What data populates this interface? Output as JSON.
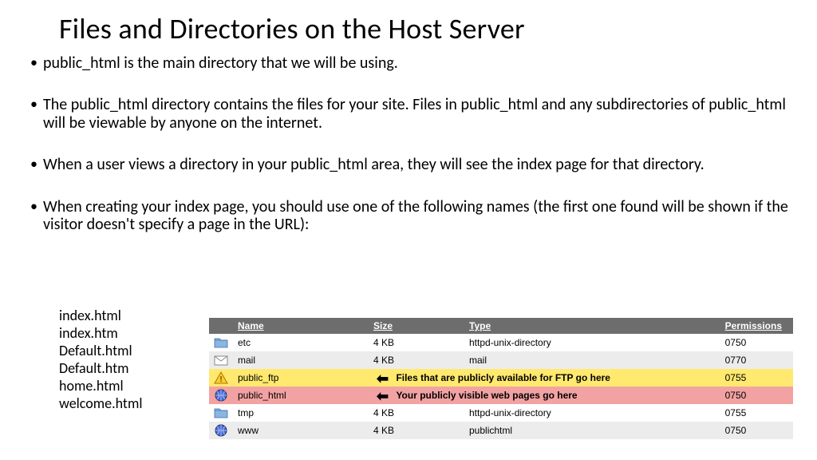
{
  "title": "Files and Directories on the Host Server",
  "bullets": [
    "public_html is the main directory that we will be using.",
    "The public_html directory contains the files for your site. Files in public_html and any subdirectories of public_html will be viewable by anyone on the internet.",
    "When a user views a directory in your public_html area, they will see the index page for that directory.",
    "When creating your index page, you should use one of the following names (the first one found will be shown if the visitor doesn't specify a page in the URL):"
  ],
  "index_names": [
    "index.html",
    "index.htm",
    "Default.html",
    "Default.htm",
    "home.html",
    "welcome.html"
  ],
  "table": {
    "headers": {
      "name": "Name",
      "size": "Size",
      "type": "Type",
      "perm": "Permissions"
    },
    "rows": [
      {
        "icon": "folder",
        "name": "etc",
        "size": "4 KB",
        "type": "httpd-unix-directory",
        "perm": "0750",
        "class": "row-even"
      },
      {
        "icon": "mail",
        "name": "mail",
        "size": "4 KB",
        "type": "mail",
        "perm": "0770",
        "class": "row-odd"
      },
      {
        "icon": "warn",
        "name": "public_ftp",
        "desc": "Files that are publicly available for FTP go here",
        "perm": "0755",
        "class": "row-yellow",
        "highlight": true
      },
      {
        "icon": "globe",
        "name": "public_html",
        "desc": "Your publicly visible web pages go here",
        "perm": "0750",
        "class": "row-pink",
        "highlight": true
      },
      {
        "icon": "folder",
        "name": "tmp",
        "size": "4 KB",
        "type": "httpd-unix-directory",
        "perm": "0755",
        "class": "row-even"
      },
      {
        "icon": "globe",
        "name": "www",
        "size": "4 KB",
        "type": "publichtml",
        "perm": "0750",
        "class": "row-odd"
      }
    ]
  },
  "icons": {
    "arrow_left": "⬅"
  }
}
